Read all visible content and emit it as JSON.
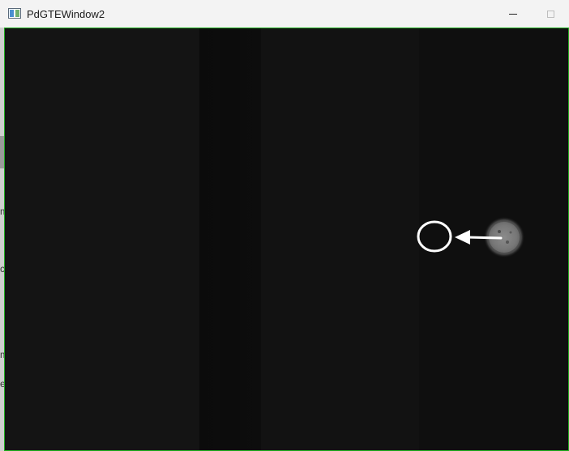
{
  "window": {
    "title": "PdGTEWindow2",
    "app_icon": "window-app-icon",
    "controls": [
      "minimize-icon",
      "maximize-icon"
    ]
  },
  "left_strip": {
    "chars": [
      "m",
      "c",
      "m",
      "e"
    ]
  },
  "viewport": {
    "border_color": "#1fae1f",
    "background": "#101010",
    "annotation": {
      "target_marker": "circle-marker-icon",
      "direction_marker": "arrow-left-icon",
      "marker_color": "#ffffff",
      "object": "bright-spot-icon"
    }
  }
}
